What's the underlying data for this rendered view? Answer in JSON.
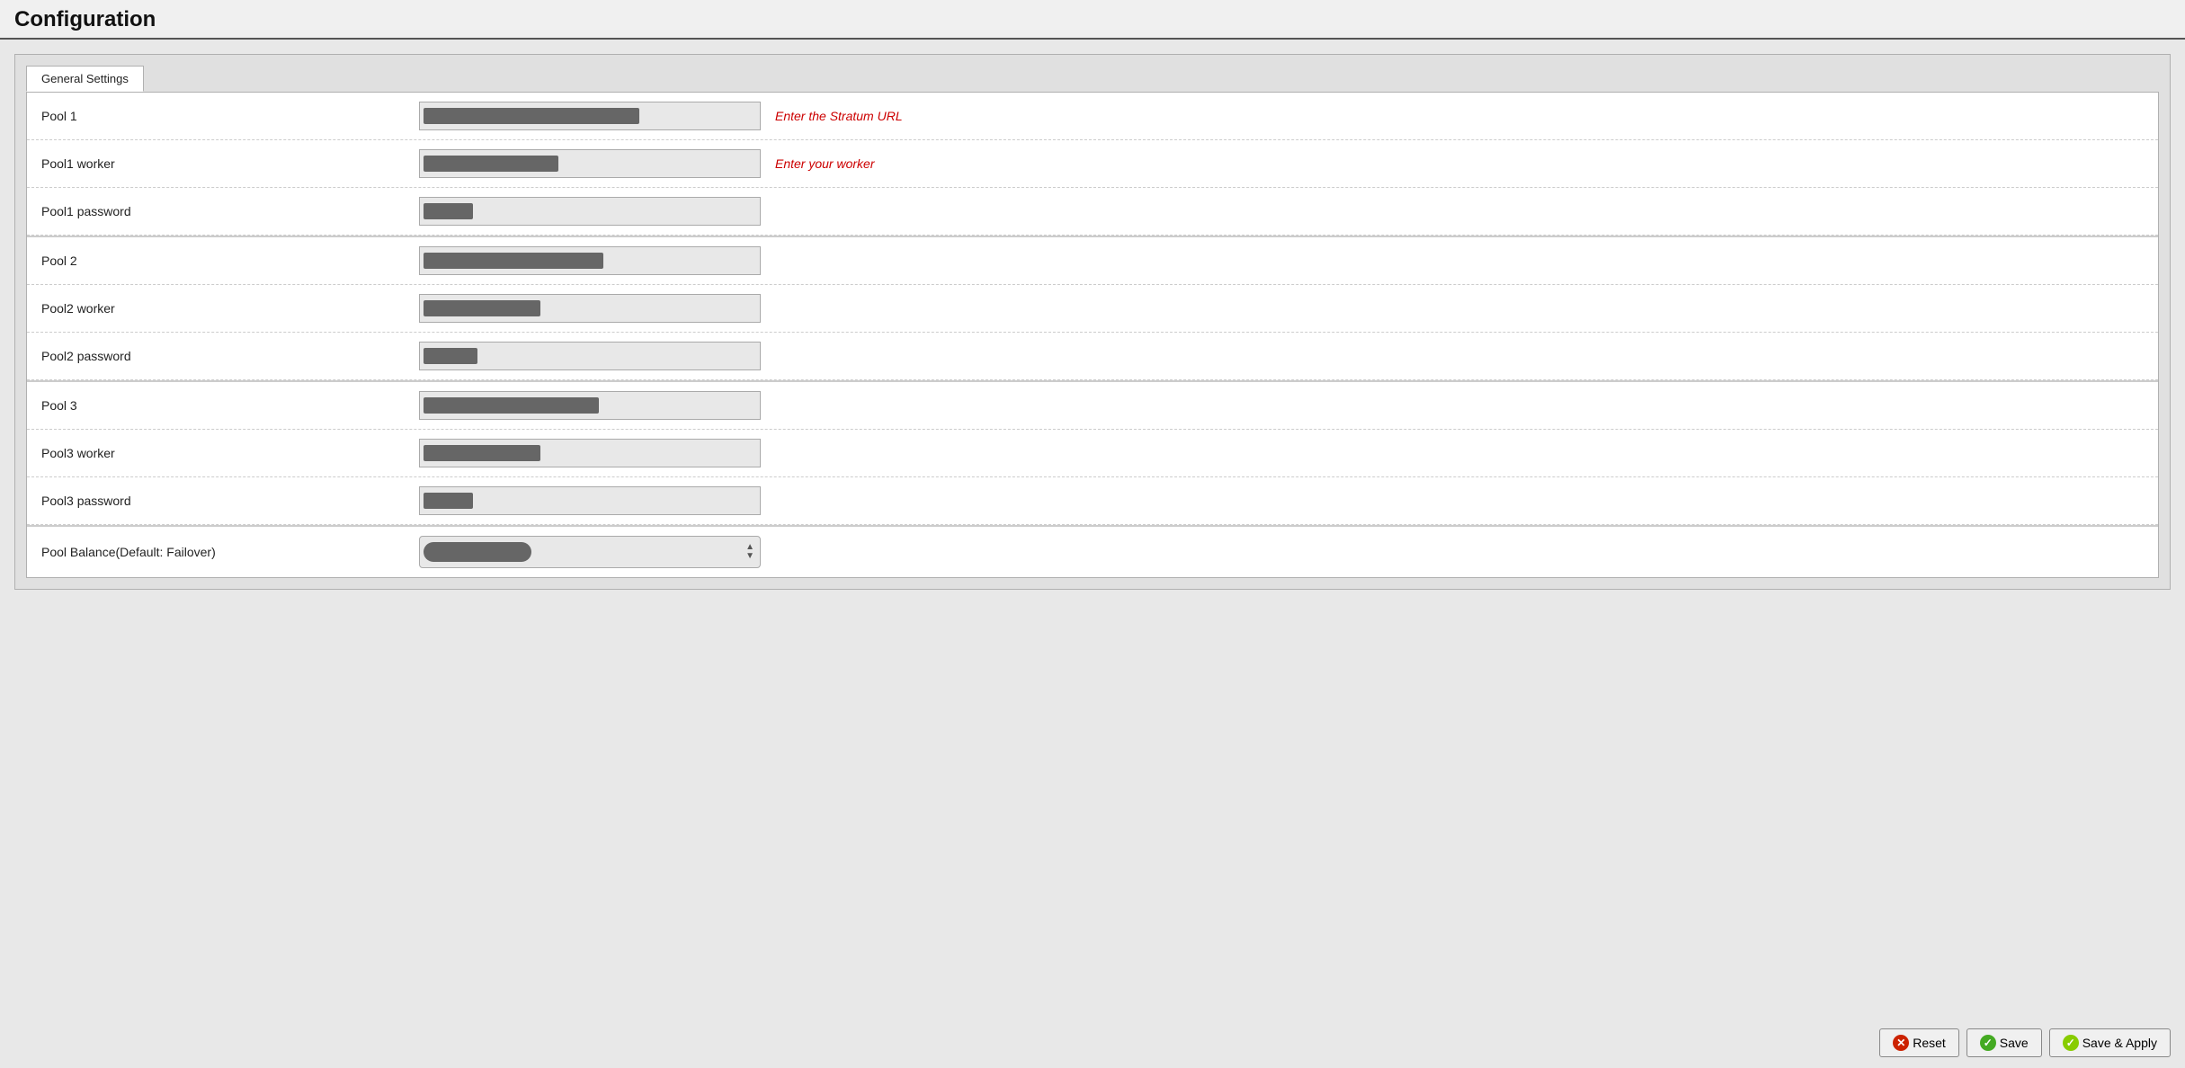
{
  "page": {
    "title": "Configuration"
  },
  "tabs": [
    {
      "label": "General Settings",
      "active": true
    }
  ],
  "form": {
    "rows": [
      {
        "id": "pool1",
        "label": "Pool 1",
        "type": "text",
        "value_bar_width": "240px",
        "hint": "Enter the Stratum URL",
        "group_start": false
      },
      {
        "id": "pool1worker",
        "label": "Pool1 worker",
        "type": "text",
        "value_bar_width": "150px",
        "hint": "Enter your worker",
        "group_start": false
      },
      {
        "id": "pool1password",
        "label": "Pool1 password",
        "type": "text",
        "value_bar_width": "55px",
        "hint": "",
        "group_start": false
      },
      {
        "id": "pool2",
        "label": "Pool 2",
        "type": "text",
        "value_bar_width": "200px",
        "hint": "",
        "group_start": true
      },
      {
        "id": "pool2worker",
        "label": "Pool2 worker",
        "type": "text",
        "value_bar_width": "130px",
        "hint": "",
        "group_start": false
      },
      {
        "id": "pool2password",
        "label": "Pool2 password",
        "type": "text",
        "value_bar_width": "60px",
        "hint": "",
        "group_start": false
      },
      {
        "id": "pool3",
        "label": "Pool 3",
        "type": "text",
        "value_bar_width": "195px",
        "hint": "",
        "group_start": true
      },
      {
        "id": "pool3worker",
        "label": "Pool3 worker",
        "type": "text",
        "value_bar_width": "130px",
        "hint": "",
        "group_start": false
      },
      {
        "id": "pool3password",
        "label": "Pool3 password",
        "type": "text",
        "value_bar_width": "55px",
        "hint": "",
        "group_start": false
      },
      {
        "id": "poolbalance",
        "label": "Pool Balance(Default: Failover)",
        "type": "select",
        "value_bar_width": "120px",
        "hint": "",
        "group_start": true
      }
    ]
  },
  "footer": {
    "buttons": [
      {
        "id": "reset",
        "label": "Reset",
        "icon_color": "#cc2200",
        "icon_char": "✕"
      },
      {
        "id": "save",
        "label": "Save",
        "icon_color": "#44aa22",
        "icon_char": "✓"
      },
      {
        "id": "save_apply",
        "label": "Save & Apply",
        "icon_color": "#88cc00",
        "icon_char": "✓"
      }
    ]
  }
}
